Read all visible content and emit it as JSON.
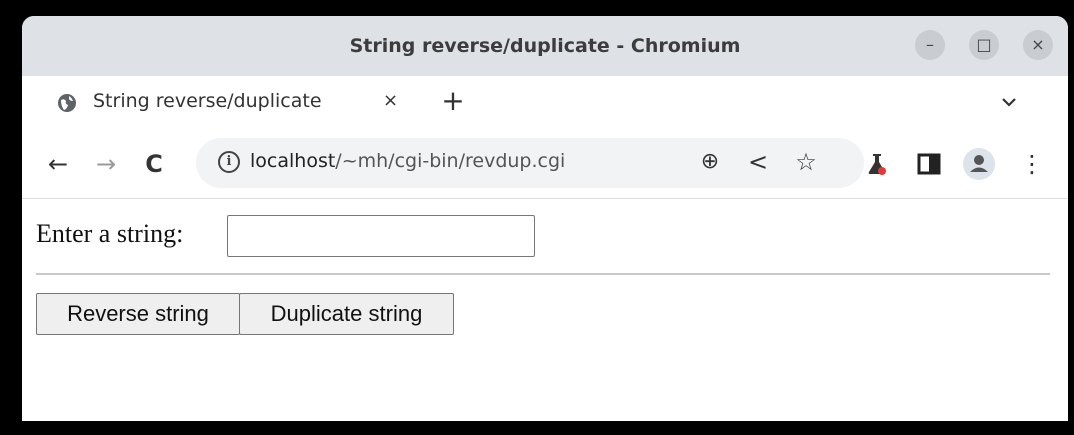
{
  "window": {
    "title": "String reverse/duplicate - Chromium",
    "controls": {
      "minimize": "–",
      "maximize": "□",
      "close": "×"
    }
  },
  "tabs": [
    {
      "label": "String reverse/duplicate",
      "close": "×",
      "icon": "globe-icon"
    }
  ],
  "newtab_label": "+",
  "toolbar": {
    "back": "←",
    "forward": "→",
    "reload": "C",
    "url_host": "localhost",
    "url_path": "/~mh/cgi-bin/revdup.cgi",
    "zoom": "⊕",
    "share": "<",
    "star": "☆",
    "menu": "⋮"
  },
  "page": {
    "prompt": "Enter a string:",
    "input_value": "",
    "buttons": [
      "Reverse string",
      "Duplicate string"
    ]
  },
  "colors": {
    "titlebar": "#dee1e6",
    "labs_accent": "#e53935"
  }
}
